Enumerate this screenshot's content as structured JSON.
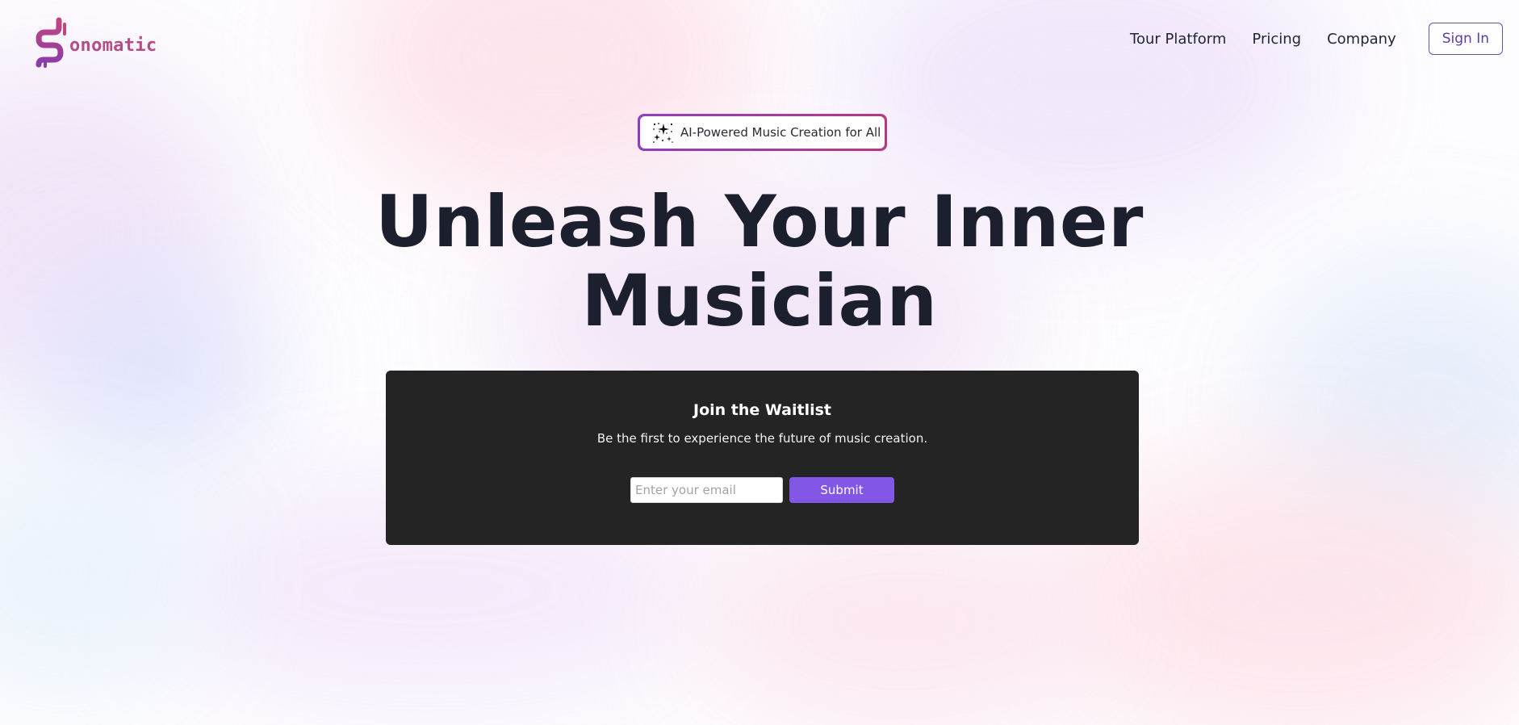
{
  "brand": {
    "name": "onomatic",
    "logo_icon": "squiggle-s-logo-icon",
    "color": "#b34e86"
  },
  "nav": {
    "items": [
      {
        "label": "Tour Platform"
      },
      {
        "label": "Pricing"
      },
      {
        "label": "Company"
      }
    ],
    "signin_label": "Sign In"
  },
  "badge": {
    "icon": "sparkles-icon",
    "text": "AI-Powered Music Creation for All"
  },
  "hero": {
    "line1": "Unleash Your Inner",
    "line2": "Musician"
  },
  "waitlist": {
    "title": "Join the Waitlist",
    "subtitle": "Be the first to experience the future of music creation.",
    "email_placeholder": "Enter your email",
    "email_value": "",
    "submit_label": "Submit"
  },
  "colors": {
    "accent": "#8257e6",
    "card_bg": "#242424",
    "headline": "#1c1f2e"
  }
}
